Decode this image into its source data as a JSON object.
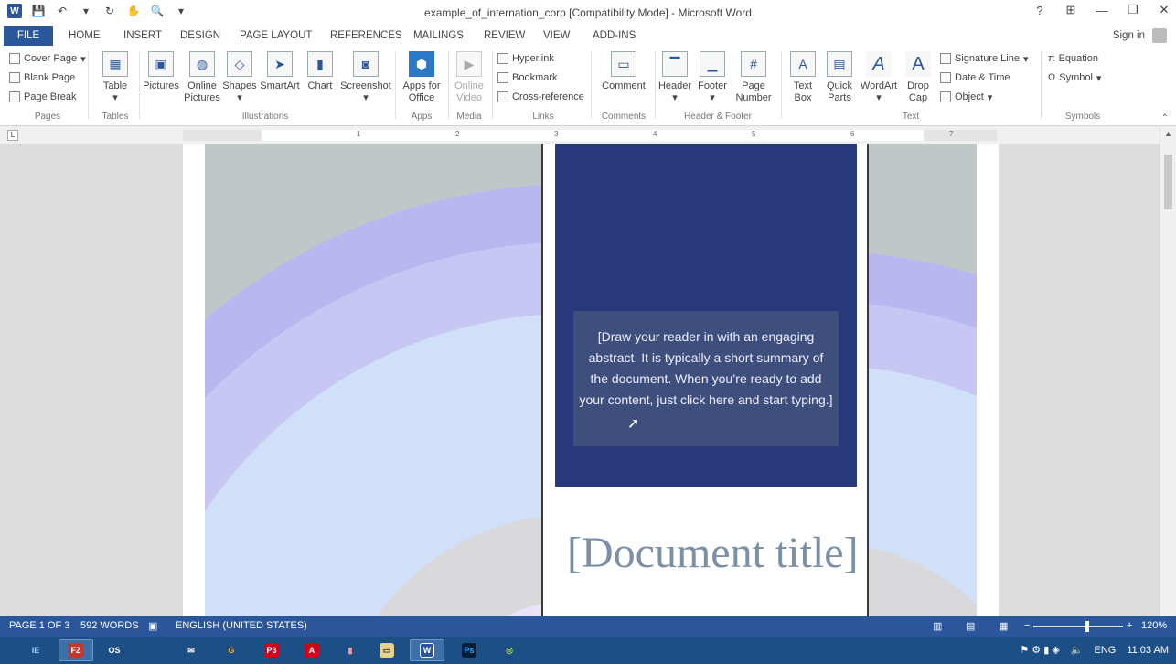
{
  "window": {
    "title": "example_of_internation_corp [Compatibility Mode] - Microsoft Word",
    "controls": {
      "help": "?",
      "ribbon_options": "⊞",
      "minimize": "—",
      "restore": "❐",
      "close": "✕"
    }
  },
  "qat": {
    "logo": "W",
    "save": "💾",
    "undo": "↶",
    "undo_menu": "▾",
    "redo": "↻",
    "touch": "✋",
    "print_preview": "🔍",
    "customize": "▾"
  },
  "tabs": [
    "FILE",
    "HOME",
    "INSERT",
    "DESIGN",
    "PAGE LAYOUT",
    "REFERENCES",
    "MAILINGS",
    "REVIEW",
    "VIEW",
    "ADD-INS"
  ],
  "signin": "Sign in",
  "ribbon": {
    "pages": {
      "cover": "Cover Page",
      "blank": "Blank Page",
      "break": "Page Break",
      "group": "Pages"
    },
    "tables": {
      "table": "Table",
      "group": "Tables"
    },
    "illustrations": {
      "pictures": "Pictures",
      "online1": "Online",
      "online2": "Pictures",
      "shapes": "Shapes",
      "smartart": "SmartArt",
      "chart": "Chart",
      "screenshot": "Screenshot",
      "group": "Illustrations"
    },
    "apps": {
      "apps1": "Apps for",
      "apps2": "Office",
      "group": "Apps"
    },
    "media": {
      "video1": "Online",
      "video2": "Video",
      "group": "Media"
    },
    "links": {
      "hyperlink": "Hyperlink",
      "bookmark": "Bookmark",
      "crossref": "Cross-reference",
      "group": "Links"
    },
    "comments": {
      "comment": "Comment",
      "group": "Comments"
    },
    "headerfooter": {
      "header": "Header",
      "footer": "Footer",
      "pagenum1": "Page",
      "pagenum2": "Number",
      "group": "Header & Footer"
    },
    "text": {
      "textbox1": "Text",
      "textbox2": "Box",
      "quick1": "Quick",
      "quick2": "Parts",
      "wordart": "WordArt",
      "dropcap1": "Drop",
      "dropcap2": "Cap",
      "sigline": "Signature Line",
      "datetime": "Date & Time",
      "object": "Object",
      "group": "Text"
    },
    "symbols": {
      "equation": "Equation",
      "symbol": "Symbol",
      "group": "Symbols"
    }
  },
  "ruler": {
    "tab_selector": "L",
    "numbers": [
      "1",
      "2",
      "3",
      "4",
      "5",
      "6",
      "7"
    ]
  },
  "document": {
    "abstract": "[Draw your reader in with an engaging abstract. It is typically a short summary of the document. When you’re ready to add your content, just click here and start typing.]",
    "title": "[Document title]"
  },
  "statusbar": {
    "page": "PAGE 1 OF 3",
    "words": "592 WORDS",
    "language": "ENGLISH (UNITED STATES)",
    "zoom_minus": "−",
    "zoom_plus": "+",
    "zoom": "120%",
    "zoom_fraction": 0.6
  },
  "taskbar": {
    "apps": [
      "IE",
      "FZ",
      "OS",
      "✉",
      "G",
      "P3",
      "A",
      "▮",
      "▭",
      "W",
      "Ps",
      "◎"
    ],
    "tray_lang": "ENG",
    "time": "11:03 AM"
  },
  "colors": {
    "word_blue": "#2b579a",
    "navy_panel": "#27397a",
    "taskbar": "#1c4f86"
  }
}
